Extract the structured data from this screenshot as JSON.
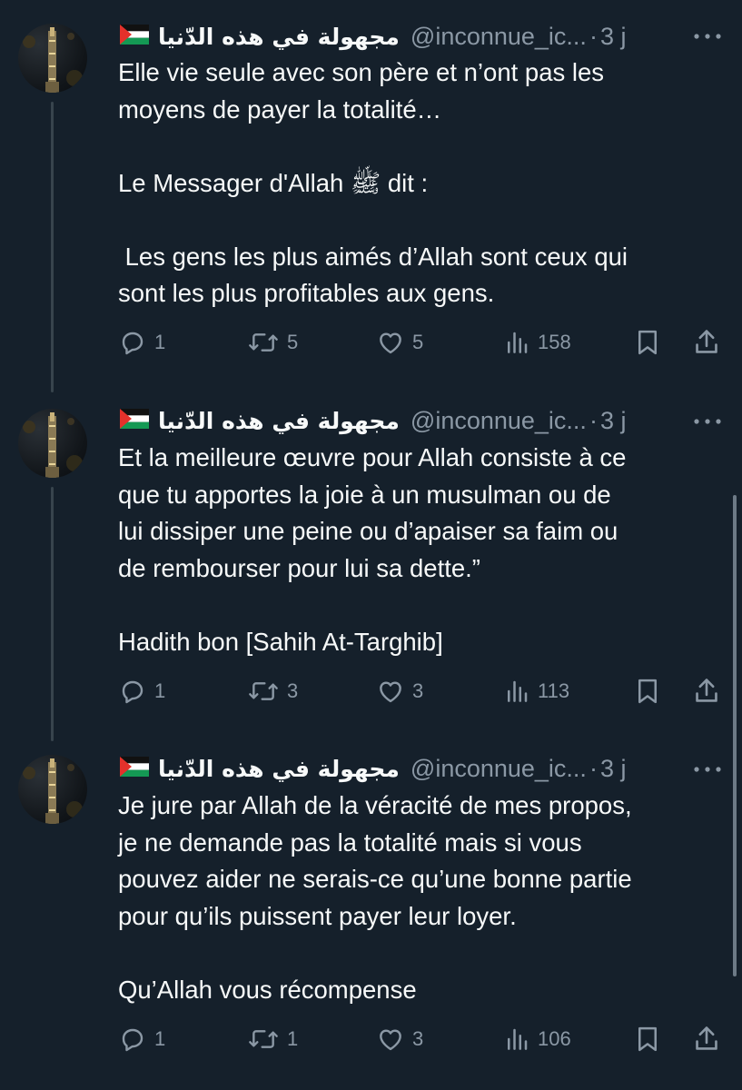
{
  "colors": {
    "background": "#15202b",
    "text": "#f7f9f9",
    "secondary": "#8b98a5",
    "thread_line": "#38444d"
  },
  "tweets": [
    {
      "name": "مجهولة في هذه الدّنيا",
      "handle": "@inconnue_ic...",
      "dot": "·",
      "time": "3 j",
      "text": "Elle vie seule avec son père et n’ont pas les\nmoyens de payer la totalité…\n\nLe Messager d'Allah ﷺ dit :\n\n Les gens les plus aimés d’Allah sont ceux qui\nsont les plus profitables aux gens.",
      "replies": "1",
      "retweets": "5",
      "likes": "5",
      "views": "158"
    },
    {
      "name": "مجهولة في هذه الدّنيا",
      "handle": "@inconnue_ic...",
      "dot": "·",
      "time": "3 j",
      "text": "Et la meilleure œuvre pour Allah consiste à ce\nque tu apportes la joie à un musulman ou de\nlui dissiper une peine ou d’apaiser sa faim ou\nde rembourser pour lui sa dette.”\n\nHadith bon [Sahih At-Targhib]",
      "replies": "1",
      "retweets": "3",
      "likes": "3",
      "views": "113"
    },
    {
      "name": "مجهولة في هذه الدّنيا",
      "handle": "@inconnue_ic...",
      "dot": "·",
      "time": "3 j",
      "text": "Je jure par Allah de la véracité de mes propos,\nje ne demande pas la totalité mais si vous\npouvez aider ne serais-ce qu’une bonne partie\npour qu’ils puissent payer leur loyer.\n\nQu’Allah vous récompense",
      "replies": "1",
      "retweets": "1",
      "likes": "3",
      "views": "106"
    }
  ],
  "icons": {
    "flag": "palestine-flag-icon",
    "avatar": "night-tower-avatar",
    "more": "more-icon",
    "reply": "reply-icon",
    "retweet": "retweet-icon",
    "like": "heart-icon",
    "views": "views-icon",
    "bookmark": "bookmark-icon",
    "share": "share-icon"
  }
}
